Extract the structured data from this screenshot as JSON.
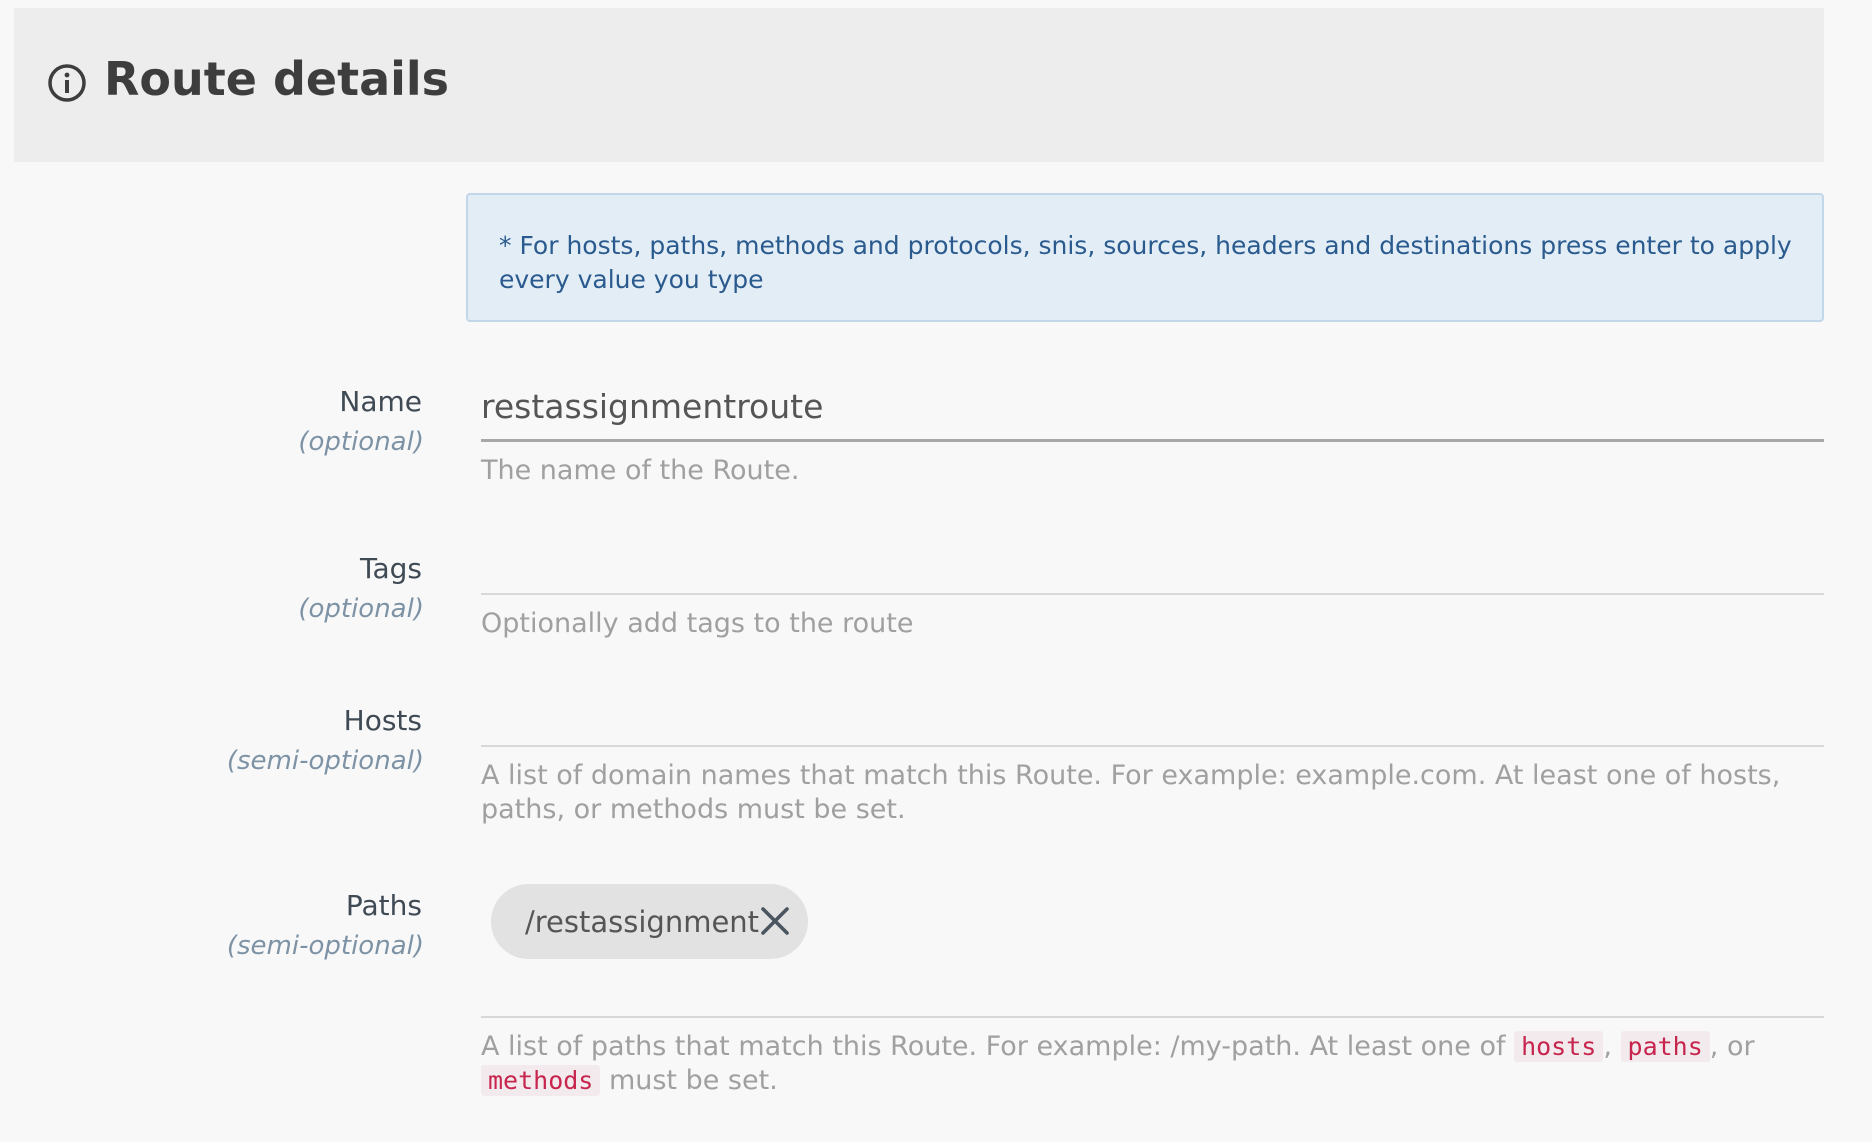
{
  "header": {
    "title": "Route details",
    "icon": "info-circle-icon"
  },
  "info_box": {
    "text": "* For hosts, paths, methods and protocols, snis, sources, headers and destinations press enter to apply every value you type"
  },
  "fields": {
    "name": {
      "label": "Name",
      "sub": "(optional)",
      "value": "restassignmentroute",
      "help": "The name of the Route."
    },
    "tags": {
      "label": "Tags",
      "sub": "(optional)",
      "value": "",
      "help": "Optionally add tags to the route"
    },
    "hosts": {
      "label": "Hosts",
      "sub": "(semi-optional)",
      "value": "",
      "help": "A list of domain names that match this Route. For example: example.com. At least one of hosts, paths, or methods must be set."
    },
    "paths": {
      "label": "Paths",
      "sub": "(semi-optional)",
      "chips": [
        "/restassignment"
      ],
      "help_prefix": "A list of paths that match this Route. For example: /my-path. At least one of",
      "help_code_1": "hosts",
      "help_sep_1": ",",
      "help_code_2": "paths",
      "help_sep_2": ", or",
      "help_code_3": "methods",
      "help_suffix": "must be set."
    }
  },
  "colors": {
    "info_text": "#2a5a8e",
    "info_bg": "#e2edf6",
    "code_text": "#c7254e",
    "label_sub": "#7d93a5"
  }
}
